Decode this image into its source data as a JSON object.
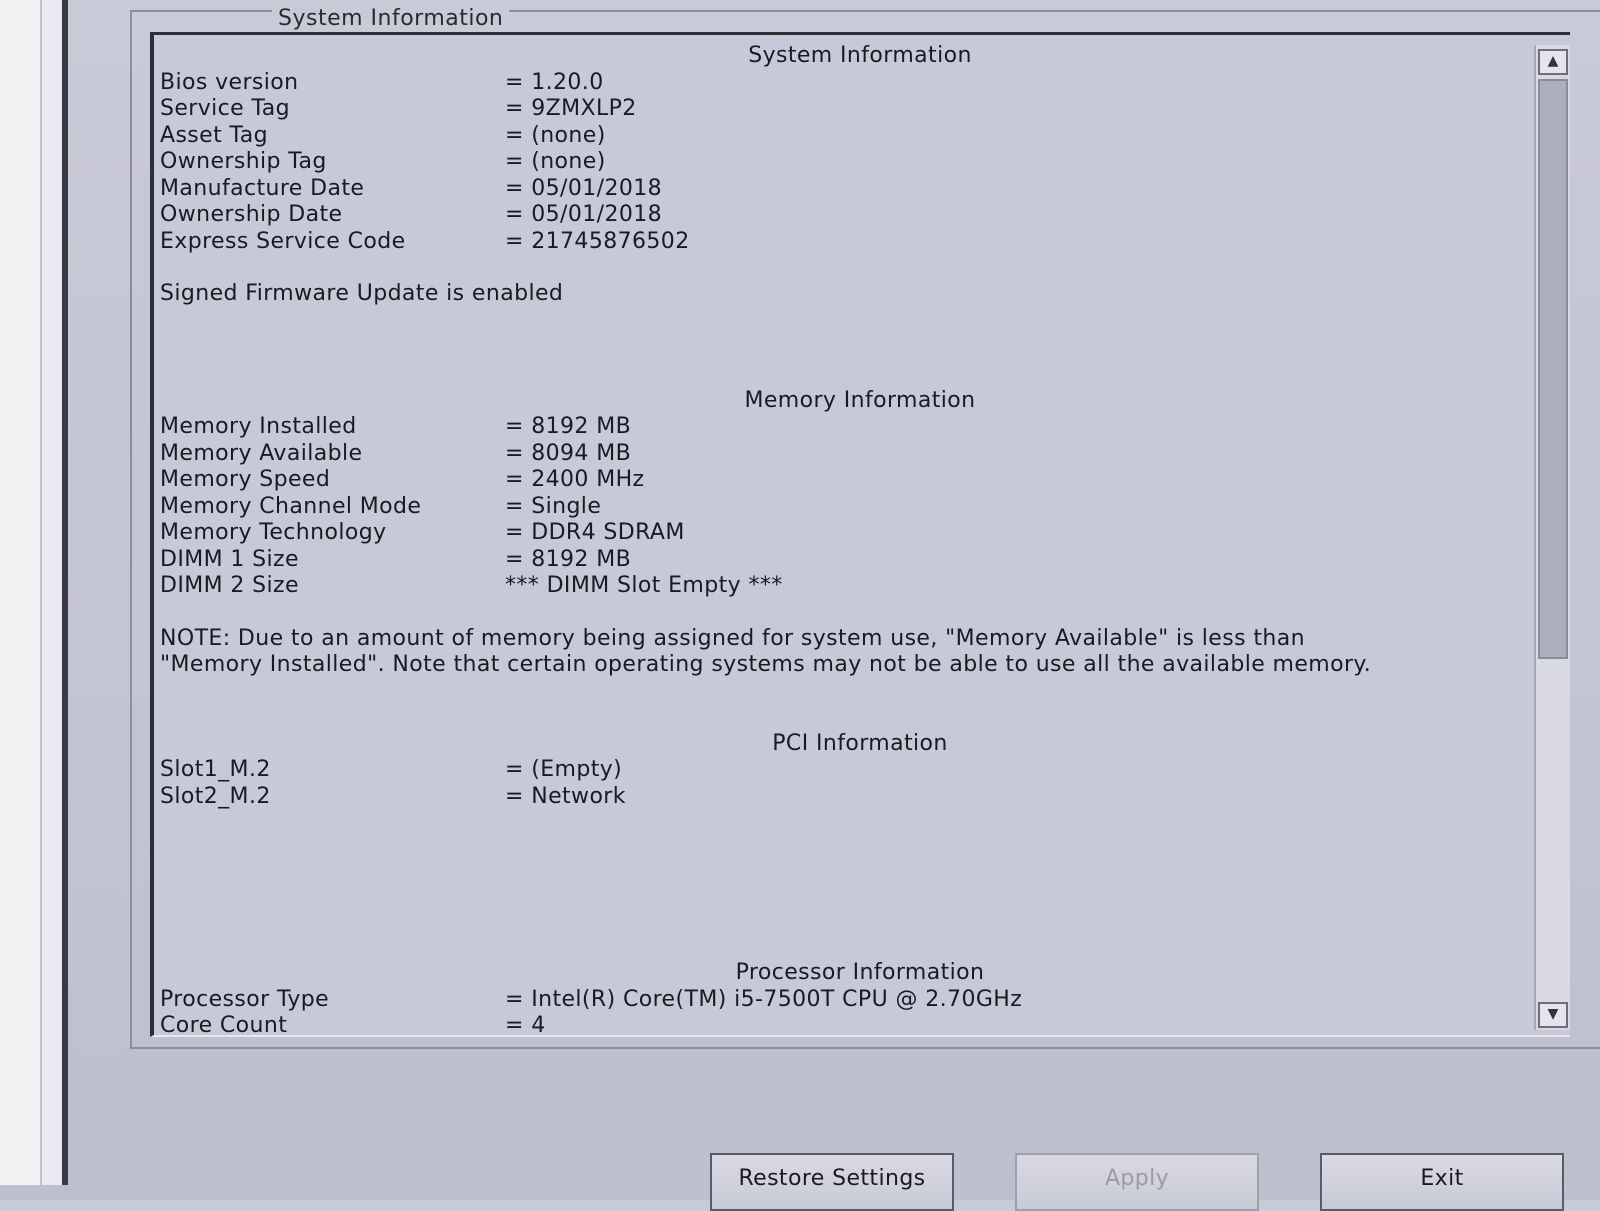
{
  "group_title": "System Information",
  "system": {
    "heading": "System Information",
    "rows": [
      {
        "label": "Bios version",
        "value": "= 1.20.0"
      },
      {
        "label": "Service Tag",
        "value": "= 9ZMXLP2"
      },
      {
        "label": "Asset Tag",
        "value": "= (none)"
      },
      {
        "label": "Ownership Tag",
        "value": "= (none)"
      },
      {
        "label": "Manufacture Date",
        "value": "= 05/01/2018"
      },
      {
        "label": "Ownership Date",
        "value": "= 05/01/2018"
      },
      {
        "label": "Express Service Code",
        "value": "= 21745876502"
      }
    ],
    "note": "Signed Firmware Update is enabled"
  },
  "memory": {
    "heading": "Memory Information",
    "rows": [
      {
        "label": "Memory Installed",
        "value": "= 8192 MB"
      },
      {
        "label": "Memory Available",
        "value": "= 8094 MB"
      },
      {
        "label": "Memory Speed",
        "value": "= 2400 MHz"
      },
      {
        "label": "Memory Channel Mode",
        "value": "= Single"
      },
      {
        "label": "Memory Technology",
        "value": "= DDR4 SDRAM"
      },
      {
        "label": "DIMM 1 Size",
        "value": "= 8192 MB"
      },
      {
        "label": "DIMM 2 Size",
        "value": "*** DIMM Slot Empty ***"
      }
    ],
    "note": "NOTE: Due to an amount of memory being assigned for system use, \"Memory Available\" is less than \"Memory Installed\". Note that certain operating systems may not be able to use all the available memory."
  },
  "pci": {
    "heading": "PCI Information",
    "rows": [
      {
        "label": "Slot1_M.2",
        "value": "= (Empty)"
      },
      {
        "label": "Slot2_M.2",
        "value": "= Network"
      }
    ]
  },
  "processor": {
    "heading": "Processor Information",
    "rows": [
      {
        "label": "Processor Type",
        "value": "= Intel(R) Core(TM) i5-7500T CPU @ 2.70GHz"
      },
      {
        "label": "Core Count",
        "value": "= 4"
      }
    ]
  },
  "buttons": {
    "restore": "Restore Settings",
    "apply": "Apply",
    "exit": "Exit"
  },
  "icons": {
    "scroll_up": "▲",
    "scroll_down": "▼"
  }
}
